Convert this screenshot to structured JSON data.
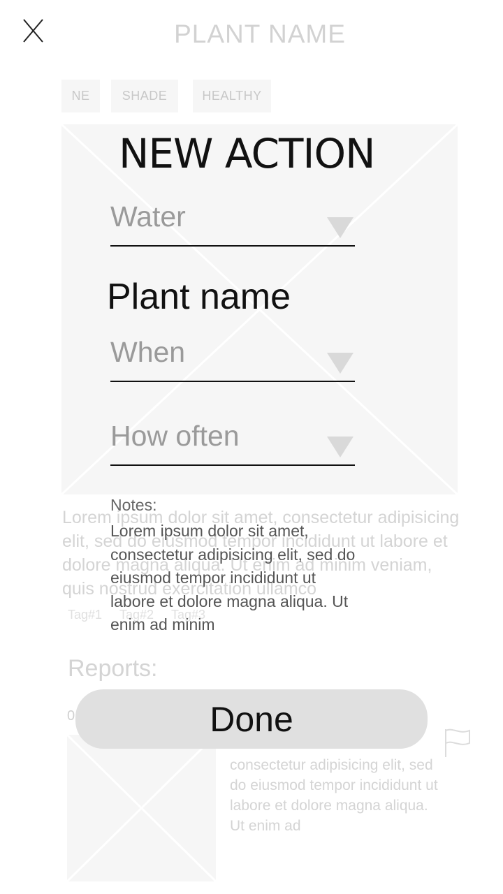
{
  "background": {
    "title": "PLANT NAME",
    "chips": [
      "NE",
      "SHADE",
      "HEALTHY"
    ],
    "description": "Lorem ipsum dolor sit amet, consectetur adipisicing elit, sed do eiusmod tempor incididunt ut labore et dolore magna aliqua. Ut enim ad minim veniam, quis nostrud exercitation ullamco",
    "tags": [
      "Tag#1",
      "Tag#2",
      "Tag#3"
    ],
    "reports_title": "Reports:",
    "report_date": "0",
    "report_text": "consectetur adipisicing elit, sed do eiusmod tempor incididunt ut labore et dolore magna aliqua. Ut enim ad"
  },
  "modal": {
    "title": "NEW ACTION",
    "action_field": {
      "value": "Water"
    },
    "plant_name": "Plant name",
    "when_field": {
      "value": "When"
    },
    "how_often_field": {
      "value": "How often"
    },
    "notes_label": "Notes:",
    "notes_text": "Lorem ipsum dolor sit amet, consectetur adipisicing elit, sed do eiusmod tempor incididunt ut labore et dolore magna aliqua. Ut enim ad minim",
    "done_label": "Done"
  },
  "icons": {
    "close": "close-icon",
    "dropdown": "triangle-down-icon",
    "flag": "flag-icon",
    "image_placeholder": "image-placeholder-icon"
  },
  "colors": {
    "modal_text": "#111111",
    "field_value": "#9a9a9a",
    "faded_text": "#d4d4d4",
    "button_bg": "#e0e0e0",
    "placeholder_bg": "#f6f6f6"
  }
}
